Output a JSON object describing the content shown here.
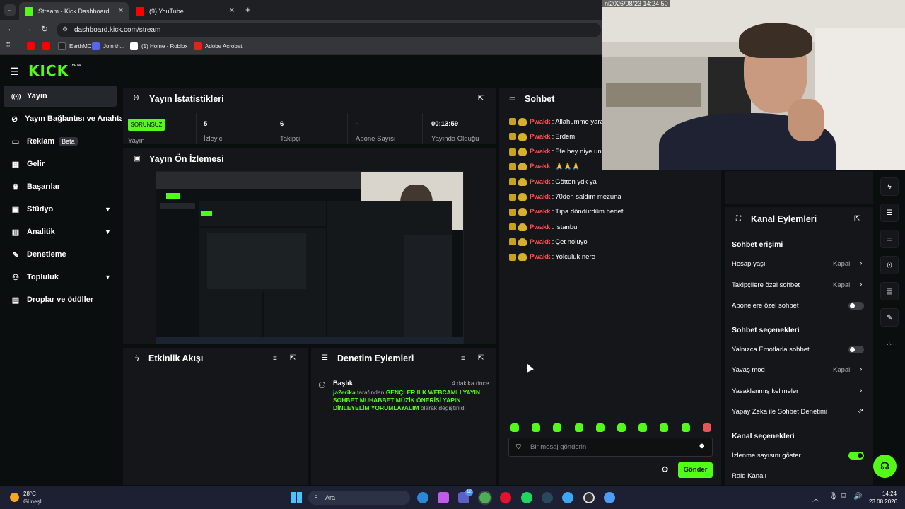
{
  "browser": {
    "tabs": [
      {
        "title": "Stream - Kick Dashboard",
        "active": true,
        "fav_color": "#53fc18"
      },
      {
        "title": "(9) YouTube",
        "active": false,
        "fav_color": "#ff0000"
      }
    ],
    "new_tab": "+",
    "url": "dashboard.kick.com/stream",
    "bookmarks": [
      {
        "label": "",
        "color": "#ff0000"
      },
      {
        "label": "",
        "color": "#ff0000"
      },
      {
        "label": "EarthMC",
        "color": "#222222"
      },
      {
        "label": "Join th...",
        "color": "#5865f2"
      },
      {
        "label": "(1) Home - Roblox",
        "color": "#ffffff"
      },
      {
        "label": "Adobe Acrobat",
        "color": "#e2231a"
      }
    ]
  },
  "app": {
    "logo": "KICK",
    "logo_sup": "BETA",
    "sidebar": [
      {
        "label": "Yayın",
        "icon": "broadcast-icon",
        "glyph": "((•))",
        "active": true,
        "expandable": false
      },
      {
        "label": "Yayın Bağlantısı ve Anahtarı",
        "icon": "link-icon",
        "glyph": "🔗",
        "active": false,
        "expandable": false
      },
      {
        "label": "Reklam",
        "icon": "ad-icon",
        "glyph": "▭",
        "active": false,
        "expandable": false,
        "badge": "Beta"
      },
      {
        "label": "Gelir",
        "icon": "revenue-icon",
        "glyph": "▦",
        "active": false,
        "expandable": false
      },
      {
        "label": "Başarılar",
        "icon": "trophy-icon",
        "glyph": "🏆",
        "active": false,
        "expandable": false
      },
      {
        "label": "Stüdyo",
        "icon": "studio-icon",
        "glyph": "▣",
        "active": false,
        "expandable": true
      },
      {
        "label": "Analitik",
        "icon": "analytics-icon",
        "glyph": "▥",
        "active": false,
        "expandable": true
      },
      {
        "label": "Denetleme",
        "icon": "wrench-icon",
        "glyph": "✎",
        "active": false,
        "expandable": false
      },
      {
        "label": "Topluluk",
        "icon": "community-icon",
        "glyph": "👥",
        "active": false,
        "expandable": true
      },
      {
        "label": "Droplar ve ödüller",
        "icon": "gift-icon",
        "glyph": "▤",
        "active": false,
        "expandable": false
      }
    ],
    "stats": {
      "title": "Yayın İstatistikleri",
      "status_badge": "SORUNSUZ",
      "status_label": "Yayın",
      "items": [
        {
          "value": "5",
          "label": "İzleyici"
        },
        {
          "value": "6",
          "label": "Takipçi"
        },
        {
          "value": "-",
          "label": "Abone Sayısı"
        },
        {
          "value": "00:13:59",
          "label": "Yayında Olduğu"
        }
      ]
    },
    "preview": {
      "title": "Yayın Ön İzlemesi"
    },
    "activity": {
      "title": "Etkinlik Akışı"
    },
    "moderation": {
      "title": "Denetim Eylemleri",
      "entry_title": "Başlık",
      "entry_time": "4 dakika önce",
      "entry_user": "ja2erika",
      "entry_by": " tarafından ",
      "entry_text": "GENÇLER İLK WEBCAMLİ YAYIN SOHBET MUHABBET MÜZİK ÖNERİSİ YAPIN DİNLEYELİM YORUMLAYALIM",
      "entry_suffix": " olarak değiştirildi"
    },
    "chat": {
      "title": "Sohbet",
      "messages": [
        {
          "user": "Pwakk",
          "text": "Allahumme yarabbim"
        },
        {
          "user": "Pwakk",
          "text": "Erdem"
        },
        {
          "user": "Pwakk",
          "text": "Efe bey niye un"
        },
        {
          "user": "Pwakk",
          "text": "🙏🙏🙏"
        },
        {
          "user": "Pwakk",
          "text": "Götten ydk ya"
        },
        {
          "user": "Pwakk",
          "text": "70den saldım mezuna"
        },
        {
          "user": "Pwakk",
          "text": "Tıpa döndürdüm hedefi"
        },
        {
          "user": "Pwakk",
          "text": "İstanbul"
        },
        {
          "user": "Pwakk",
          "text": "Çet noluyo"
        },
        {
          "user": "Pwakk",
          "text": "Yolculuk nere"
        }
      ],
      "input_placeholder": "Bir mesaj gönderin",
      "send_label": "Gönder"
    },
    "channel_actions": {
      "title": "Kanal Eylemleri",
      "chat_access": "Sohbet erişimi",
      "account_age": {
        "label": "Hesap yaşı",
        "value": "Kapalı"
      },
      "followers_only": {
        "label": "Takipçilere özel sohbet",
        "value": "Kapalı"
      },
      "subs_only": {
        "label": "Abonelere özel sohbet",
        "on": false
      },
      "chat_options": "Sohbet seçenekleri",
      "emote_only": {
        "label": "Yalnızca Emotlarla sohbet",
        "on": false
      },
      "slow_mode": {
        "label": "Yavaş mod",
        "value": "Kapalı"
      },
      "banned_words": {
        "label": "Yasaklanmış kelimeler"
      },
      "ai_moderation": {
        "label": "Yapay Zeka ile Sohbet Denetimi"
      },
      "channel_options": "Kanal seçenekleri",
      "show_viewers": {
        "label": "İzlenme sayısını göster",
        "on": true
      },
      "raid": {
        "label": "Raid Kanalı"
      }
    }
  },
  "webcam": {
    "timestamp": "ni2026/08/23  14:24:50"
  },
  "taskbar": {
    "temp": "28°C",
    "weather": "Güneşli",
    "search": "Ara",
    "time": "14:24",
    "date": "23.08.2026",
    "notif_badge": "12"
  },
  "colors": {
    "brand": "#53fc18",
    "danger": "#ff4d4f"
  }
}
